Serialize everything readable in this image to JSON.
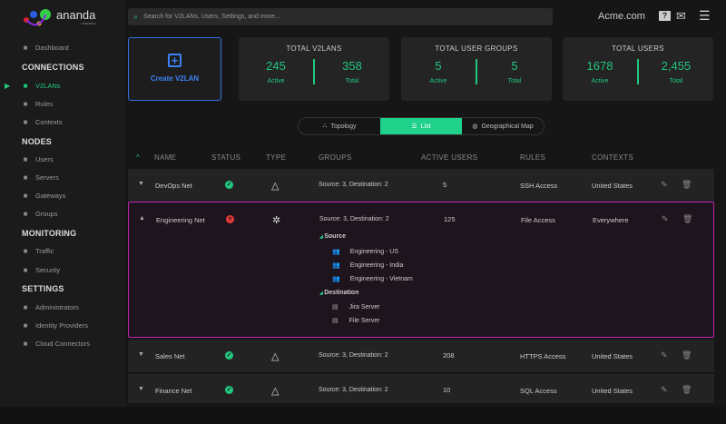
{
  "brand": {
    "name": "ananda",
    "tagline": "networks"
  },
  "sidebar": {
    "sections": [
      {
        "title": "",
        "items": [
          {
            "label": "Dashboard",
            "icon": "dashboard-icon"
          }
        ]
      },
      {
        "title": "CONNECTIONS",
        "items": [
          {
            "label": "V2LANs",
            "icon": "network-icon",
            "active": true
          },
          {
            "label": "Rules",
            "icon": "rules-icon"
          },
          {
            "label": "Contexts",
            "icon": "contexts-icon"
          }
        ]
      },
      {
        "title": "NODES",
        "items": [
          {
            "label": "Users",
            "icon": "user-icon"
          },
          {
            "label": "Servers",
            "icon": "server-icon"
          },
          {
            "label": "Gateways",
            "icon": "gateway-icon"
          },
          {
            "label": "Groups",
            "icon": "folder-icon"
          }
        ]
      },
      {
        "title": "MONITORING",
        "items": [
          {
            "label": "Traffic",
            "icon": "pulse-icon"
          },
          {
            "label": "Security",
            "icon": "shield-icon"
          }
        ]
      },
      {
        "title": "SETTINGS",
        "items": [
          {
            "label": "Administrators",
            "icon": "admin-icon"
          },
          {
            "label": "Identity Providers",
            "icon": "id-card-icon"
          },
          {
            "label": "Cloud Connectors",
            "icon": "cloud-icon"
          }
        ]
      }
    ]
  },
  "header": {
    "search_placeholder": "Search for V2LANs, Users, Settings, and more...",
    "org": "Acme.com"
  },
  "create_label": "Create V2LAN",
  "stats": [
    {
      "title": "TOTAL V2LANS",
      "a": "245",
      "a_label": "Active",
      "b": "358",
      "b_label": "Total"
    },
    {
      "title": "TOTAL USER GROUPS",
      "a": "5",
      "a_label": "Active",
      "b": "5",
      "b_label": "Total"
    },
    {
      "title": "TOTAL USERS",
      "a": "1678",
      "a_label": "Active",
      "b": "2,455",
      "b_label": "Total"
    }
  ],
  "views": [
    {
      "label": "Topology"
    },
    {
      "label": "List",
      "active": true
    },
    {
      "label": "Geographical Map"
    }
  ],
  "columns": [
    "NAME",
    "STATUS",
    "TYPE",
    "GROUPS",
    "ACTIVE USERS",
    "RULES",
    "CONTEXTS"
  ],
  "rows": [
    {
      "name": "DevOps  Net",
      "status": "ok",
      "groups": "Source: 3, Destination: 2",
      "users": "5",
      "rules": "SSH Access",
      "contexts": "United States"
    },
    {
      "name": "Engineering  Net",
      "status": "error",
      "groups": "Source: 3, Destination: 2",
      "users": "125",
      "rules": "File Access",
      "contexts": "Everywhere"
    },
    {
      "name": "Sales  Net",
      "status": "ok",
      "groups": "Source: 3, Destination: 2",
      "users": "208",
      "rules": "HTTPS Access",
      "contexts": "United States"
    },
    {
      "name": "Finance  Net",
      "status": "ok",
      "groups": "Source: 3, Destination: 2",
      "users": "10",
      "rules": "SQL Access",
      "contexts": "United States"
    }
  ],
  "expanded": {
    "source_label": "Source",
    "sources": [
      "Engineering - US",
      "Engineering - India",
      "Engineering - Vietnam"
    ],
    "dest_label": "Destination",
    "destinations": [
      "Jira Server",
      "File Server"
    ]
  },
  "colors": {
    "accent": "#22c77f",
    "error": "#e53935",
    "expanded_border": "#c026b0",
    "create": "#2f74e0"
  }
}
